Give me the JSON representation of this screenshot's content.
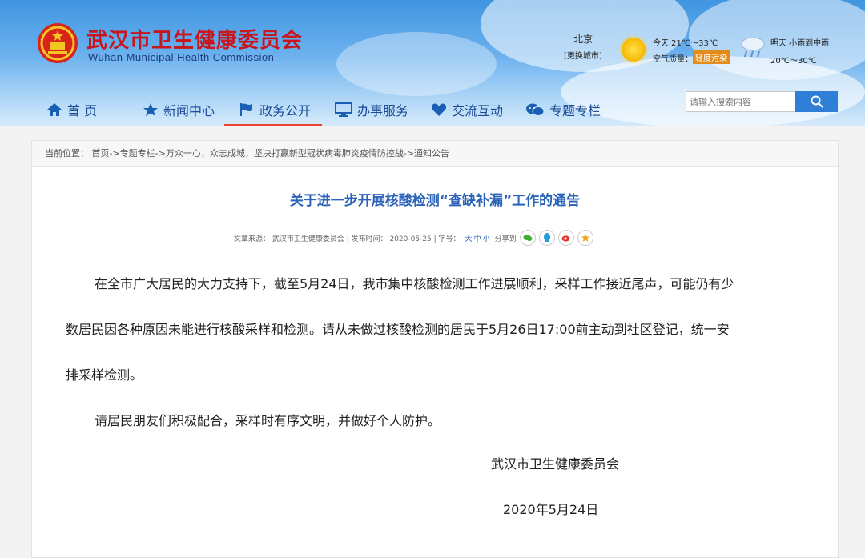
{
  "site": {
    "title": "武汉市卫生健康委员会",
    "subtitle": "Wuhan Municipal Health Commission"
  },
  "weather": {
    "city": "北京",
    "switch_city": "[更换城市]",
    "today": "今天  21℃～33℃",
    "air_quality_label": "空气质量：",
    "air_quality": "轻度污染",
    "tomorrow": "明天  小雨到中雨",
    "tomorrow_temp": "20℃～30℃"
  },
  "nav": {
    "items": [
      {
        "label": "首 页",
        "icon": "home-icon"
      },
      {
        "label": "新闻中心",
        "icon": "star-icon"
      },
      {
        "label": "政务公开",
        "icon": "flag-icon"
      },
      {
        "label": "办事服务",
        "icon": "monitor-icon"
      },
      {
        "label": "交流互动",
        "icon": "heart-icon"
      },
      {
        "label": "专题专栏",
        "icon": "chat-icon"
      }
    ],
    "active": "政务公开"
  },
  "search": {
    "placeholder": "请输入搜索内容"
  },
  "breadcrumb": "当前位置： 首页->专题专栏->万众一心，众志成城，坚决打赢新型冠状病毒肺炎疫情防控战->通知公告",
  "article": {
    "title": "关于进一步开展核酸检测“查缺补漏”工作的通告",
    "meta_source": "文章来源：  武汉市卫生健康委员会 | 发布时间：  2020-05-25  | 字号：",
    "font_large": "大",
    "font_medium": "中",
    "font_small": "小",
    "share_label": "分享到",
    "paragraph1_line1": "在全市广大居民的大力支持下，截至5月24日，我市集中核酸检测工作进展顺利，采样工作接近尾声，可能仍有少",
    "paragraph1_line2": "数居民因各种原因未能进行核酸采样和检测。请从未做过核酸检测的居民于5月26日17:00前主动到社区登记，统一安",
    "paragraph1_line3": "排采样检测。",
    "paragraph2": "请居民朋友们积极配合，采样时有序文明，并做好个人防护。",
    "signature": "武汉市卫生健康委员会",
    "date": "2020年5月24日"
  }
}
